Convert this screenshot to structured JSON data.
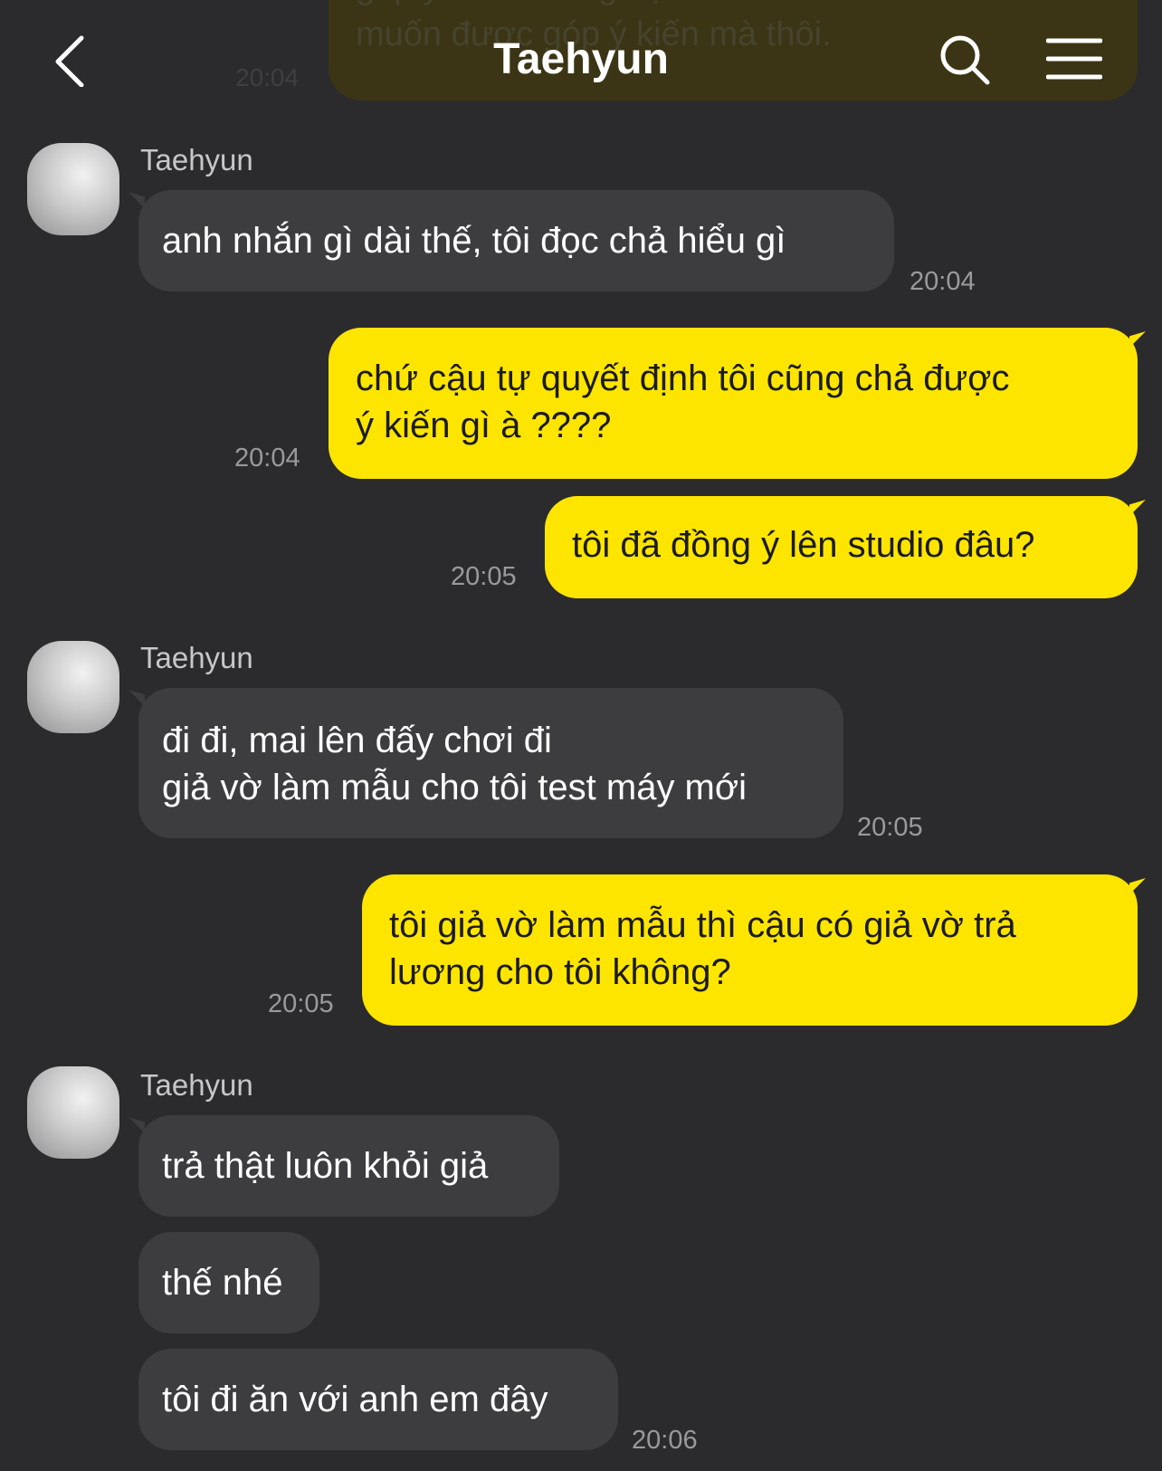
{
  "header": {
    "title": "Taehyun",
    "back_icon": "chevron-left-icon",
    "search_icon": "search-icon",
    "menu_icon": "hamburger-menu-icon"
  },
  "previous": {
    "text": "góp ý kiến .Mong bạn hiểu vì mình chỉ\nmuốn được góp ý kiến mà thôi.",
    "time": "20:04"
  },
  "messages": [
    {
      "side": "in",
      "sender": "Taehyun",
      "text": "anh nhắn gì dài thế, tôi đọc chả hiểu gì",
      "time": "20:04"
    },
    {
      "side": "out",
      "text": "chứ cậu tự quyết định tôi cũng chả được\ný kiến gì à ????",
      "time": "20:04"
    },
    {
      "side": "out",
      "text": "tôi đã đồng ý lên studio đâu?",
      "time": "20:05"
    },
    {
      "side": "in",
      "sender": "Taehyun",
      "text": "đi đi, mai lên đấy chơi đi\ngiả vờ làm mẫu cho tôi test máy mới",
      "time": "20:05"
    },
    {
      "side": "out",
      "text": "tôi giả vờ làm mẫu thì cậu có giả vờ trả\nlương cho tôi không?",
      "time": "20:05"
    },
    {
      "side": "in",
      "sender": "Taehyun",
      "text": "trả thật luôn khỏi giả"
    },
    {
      "side": "in",
      "text": "thế nhé"
    },
    {
      "side": "in",
      "text": "tôi đi ăn với anh em đây",
      "time": "20:06"
    }
  ],
  "colors": {
    "background": "#2b2b2e",
    "incoming_bubble": "#3d3d40",
    "outgoing_bubble": "#fee500",
    "timestamp": "#9a9a9c"
  }
}
